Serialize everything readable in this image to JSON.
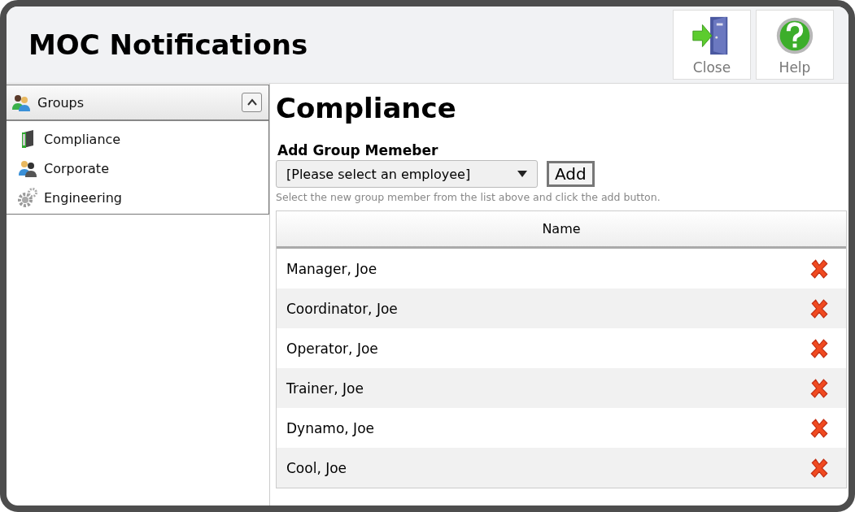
{
  "window": {
    "title": "MOC Notifications"
  },
  "toolbar": [
    {
      "label": "Close",
      "kind": "exit"
    },
    {
      "label": "Help",
      "kind": "help"
    }
  ],
  "sidebar": {
    "title": "Groups",
    "expanded": true,
    "items": [
      {
        "label": "Compliance",
        "kind": "binder"
      },
      {
        "label": "Corporate",
        "kind": "people"
      },
      {
        "label": "Engineering",
        "kind": "gears"
      }
    ]
  },
  "content": {
    "heading": "Compliance",
    "add_label": "Add Group Memeber",
    "employee_select": {
      "value": "[Please select an employee]"
    },
    "add_button": "Add",
    "hint": "Select the new group member from the list above and click the add button.",
    "table": {
      "columns": [
        "Name"
      ],
      "rows": [
        {
          "name": "Manager, Joe"
        },
        {
          "name": "Coordinator, Joe"
        },
        {
          "name": "Operator, Joe"
        },
        {
          "name": "Trainer, Joe"
        },
        {
          "name": "Dynamo, Joe"
        },
        {
          "name": "Cool, Joe"
        }
      ]
    }
  }
}
